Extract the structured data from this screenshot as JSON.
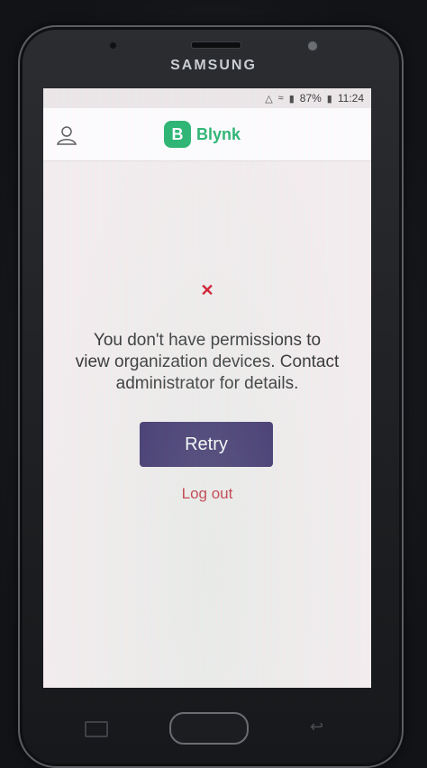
{
  "device": {
    "brand": "SAMSUNG"
  },
  "status_bar": {
    "battery": "87%",
    "time": "11:24"
  },
  "app_bar": {
    "logo_letter": "B",
    "logo_text": "Blynk"
  },
  "error": {
    "icon": "close-icon",
    "message_line1": "You don't have permissions to",
    "message_line2": "view organization devices. Contact",
    "message_line3": "administrator for details."
  },
  "actions": {
    "retry_label": "Retry",
    "logout_label": "Log out"
  },
  "colors": {
    "brand_green": "#1fb36b",
    "button_purple": "#2e2060",
    "error_red": "#d0021b",
    "link_red": "#c0182a"
  }
}
